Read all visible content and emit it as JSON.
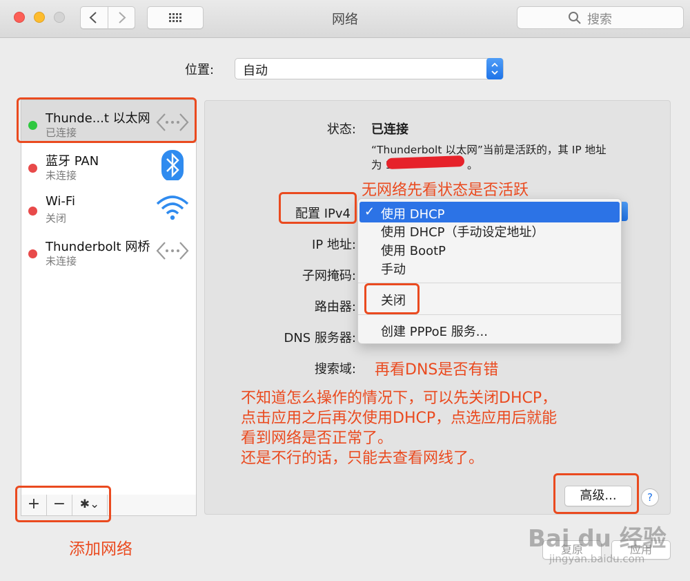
{
  "window": {
    "title": "网络",
    "search_placeholder": "搜索"
  },
  "location": {
    "label": "位置:",
    "value": "自动"
  },
  "sidebar": {
    "services": [
      {
        "name": "Thunde...t 以太网",
        "status": "已连接",
        "dot_color": "#2fc840",
        "icon": "ethernet-arrows-icon"
      },
      {
        "name": "蓝牙 PAN",
        "status": "未连接",
        "dot_color": "#e84a4a",
        "icon": "bluetooth-icon"
      },
      {
        "name": "Wi-Fi",
        "status": "关闭",
        "dot_color": "#e84a4a",
        "icon": "wifi-icon"
      },
      {
        "name": "Thunderbolt 网桥",
        "status": "未连接",
        "dot_color": "#e84a4a",
        "icon": "ethernet-arrows-icon"
      }
    ],
    "toolbar": {
      "add": "+",
      "remove": "−",
      "gear": "✱⌄"
    }
  },
  "detail": {
    "status_label": "状态:",
    "status_value": "已连接",
    "status_desc_line1": "“Thunderbolt 以太网”当前是活跃的，其 IP 地址",
    "status_desc_line2_prefix": "为 1",
    "status_desc_line2_suffix": "。",
    "configure_label": "配置 IPv4",
    "ip_label": "IP 地址:",
    "subnet_label": "子网掩码:",
    "router_label": "路由器:",
    "dns_label": "DNS 服务器:",
    "search_domains_label": "搜索域:",
    "advanced_button": "高级...",
    "help_button": "?",
    "revert_button": "复原",
    "apply_button": "应用"
  },
  "ipv4_menu": {
    "checkmark": "✓",
    "items": [
      "使用 DHCP",
      "使用 DHCP（手动设定地址）",
      "使用 BootP",
      "手动",
      "关闭",
      "创建 PPPoE 服务..."
    ],
    "selected_index": 0
  },
  "annotations": {
    "status_hint": "无网络先看状态是否活跃",
    "dns_hint": "再看DNS是否有错",
    "instructions": [
      "不知道怎么操作的情况下，可以先关闭DHCP，",
      "点击应用之后再次使用DHCP，点选应用后就能",
      "看到网络是否正常了。",
      "还是不行的话，只能去查看网线了。"
    ],
    "add_network": "添加网络",
    "color": "#ea4a1f"
  },
  "watermark": {
    "brand": "Bai du 经验",
    "url": "jingyan.baidu.com"
  }
}
